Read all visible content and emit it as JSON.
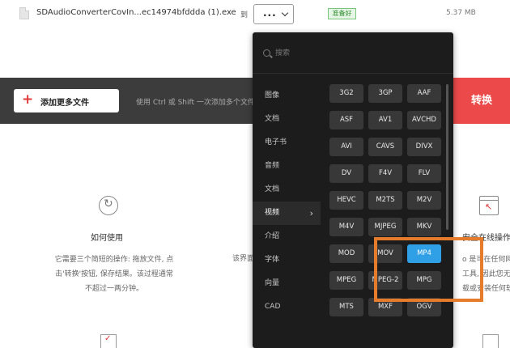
{
  "file_row": {
    "file_name": "SDAudioConverterCovIn...ec14974bfddda (1).exe",
    "to_label": "到",
    "selected_format": "...",
    "status": "准备好",
    "file_size": "5.37 MB"
  },
  "action_bar": {
    "add_more_label": "添加更多文件",
    "hint": "使用 Ctrl 或 Shift 一次添加多个文件",
    "convert_label": "转换"
  },
  "info": {
    "how_to_title": "如何使用",
    "how_to_desc": [
      "它需要三个简短的操作: 拖放文件, 点",
      "击'转换'按钮, 保存结果。该过程通常",
      "不超过一两分钟。"
    ],
    "middle_text": "该界面",
    "safe_title": "安全在线操作",
    "safe_desc": [
      "o 是可在任何网络",
      "工具, 因此您无",
      "载或安装任何软件"
    ]
  },
  "dropdown": {
    "search_placeholder": "搜索",
    "categories": [
      "图像",
      "文档",
      "电子书",
      "音频",
      "文档",
      "视频",
      "介绍",
      "字体",
      "向量",
      "CAD"
    ],
    "active_category": "视频",
    "formats": [
      "3G2",
      "3GP",
      "AAF",
      "ASF",
      "AV1",
      "AVCHD",
      "AVI",
      "CAVS",
      "DIVX",
      "DV",
      "F4V",
      "FLV",
      "HEVC",
      "M2TS",
      "M2V",
      "M4V",
      "MJPEG",
      "MKV",
      "MOD",
      "MOV",
      "MP4",
      "MPEG",
      "MPEG-2",
      "MPG",
      "MTS",
      "MXF",
      "OGV"
    ],
    "selected_format": "MP4"
  },
  "colors": {
    "accent_red": "#ec4a4a",
    "selected_blue": "#2f9fe6",
    "highlight_orange": "#e67c2b",
    "status_green": "#2e8b2e"
  }
}
